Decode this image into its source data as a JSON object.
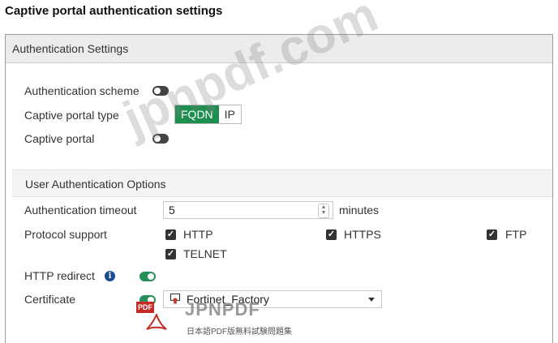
{
  "page_title": "Captive portal authentication settings",
  "panel": {
    "header": "Authentication Settings",
    "authentication_scheme": {
      "label": "Authentication scheme",
      "enabled": false
    },
    "captive_portal_type": {
      "label": "Captive portal type",
      "options": [
        "FQDN",
        "IP"
      ],
      "selected": "FQDN"
    },
    "captive_portal": {
      "label": "Captive portal",
      "enabled": false
    }
  },
  "user_auth": {
    "header": "User Authentication Options",
    "timeout": {
      "label": "Authentication timeout",
      "value": "5",
      "unit": "minutes"
    },
    "protocol": {
      "label": "Protocol support",
      "items": [
        {
          "label": "HTTP",
          "checked": true
        },
        {
          "label": "HTTPS",
          "checked": true
        },
        {
          "label": "FTP",
          "checked": true
        },
        {
          "label": "TELNET",
          "checked": true
        }
      ]
    },
    "http_redirect": {
      "label": "HTTP redirect",
      "enabled": true
    },
    "certificate": {
      "label": "Certificate",
      "enabled": true,
      "value": "Fortinet_Factory"
    }
  },
  "watermark": {
    "text": "jpnpdf.com",
    "logo_badge": "PDF",
    "logo_text": "JPNPDF",
    "logo_sub": "日本語PDF版無料試験問題集"
  },
  "colors": {
    "accent_green": "#1e8f4f",
    "toggle_dark": "#444444",
    "info_blue": "#1b4c8f"
  }
}
